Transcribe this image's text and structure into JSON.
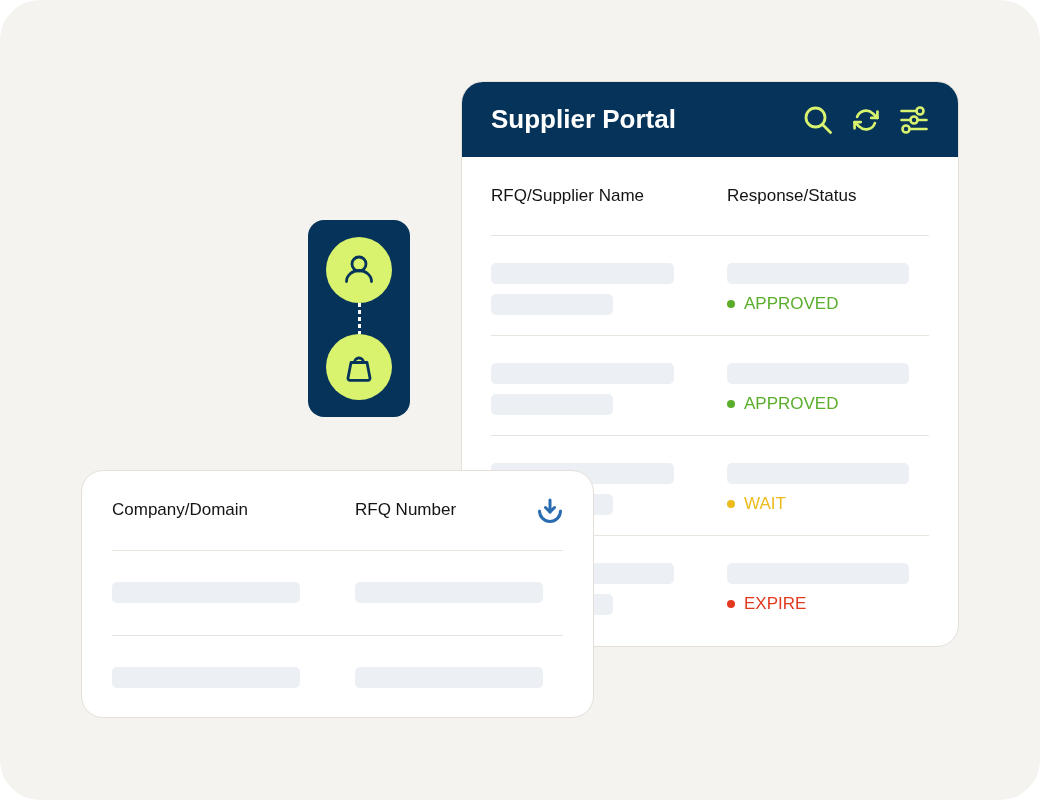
{
  "supplier_portal": {
    "title": "Supplier Portal",
    "columns": [
      "RFQ/Supplier Name",
      "Response/Status"
    ],
    "rows": [
      {
        "status": "APPROVED",
        "color": "#5aae2b"
      },
      {
        "status": "APPROVED",
        "color": "#5aae2b"
      },
      {
        "status": "WAIT",
        "color": "#ecbb1b"
      },
      {
        "status": "EXPIRE",
        "color": "#e3391f"
      }
    ]
  },
  "rfq_table": {
    "columns": [
      "Company/Domain",
      "RFQ Number"
    ]
  }
}
